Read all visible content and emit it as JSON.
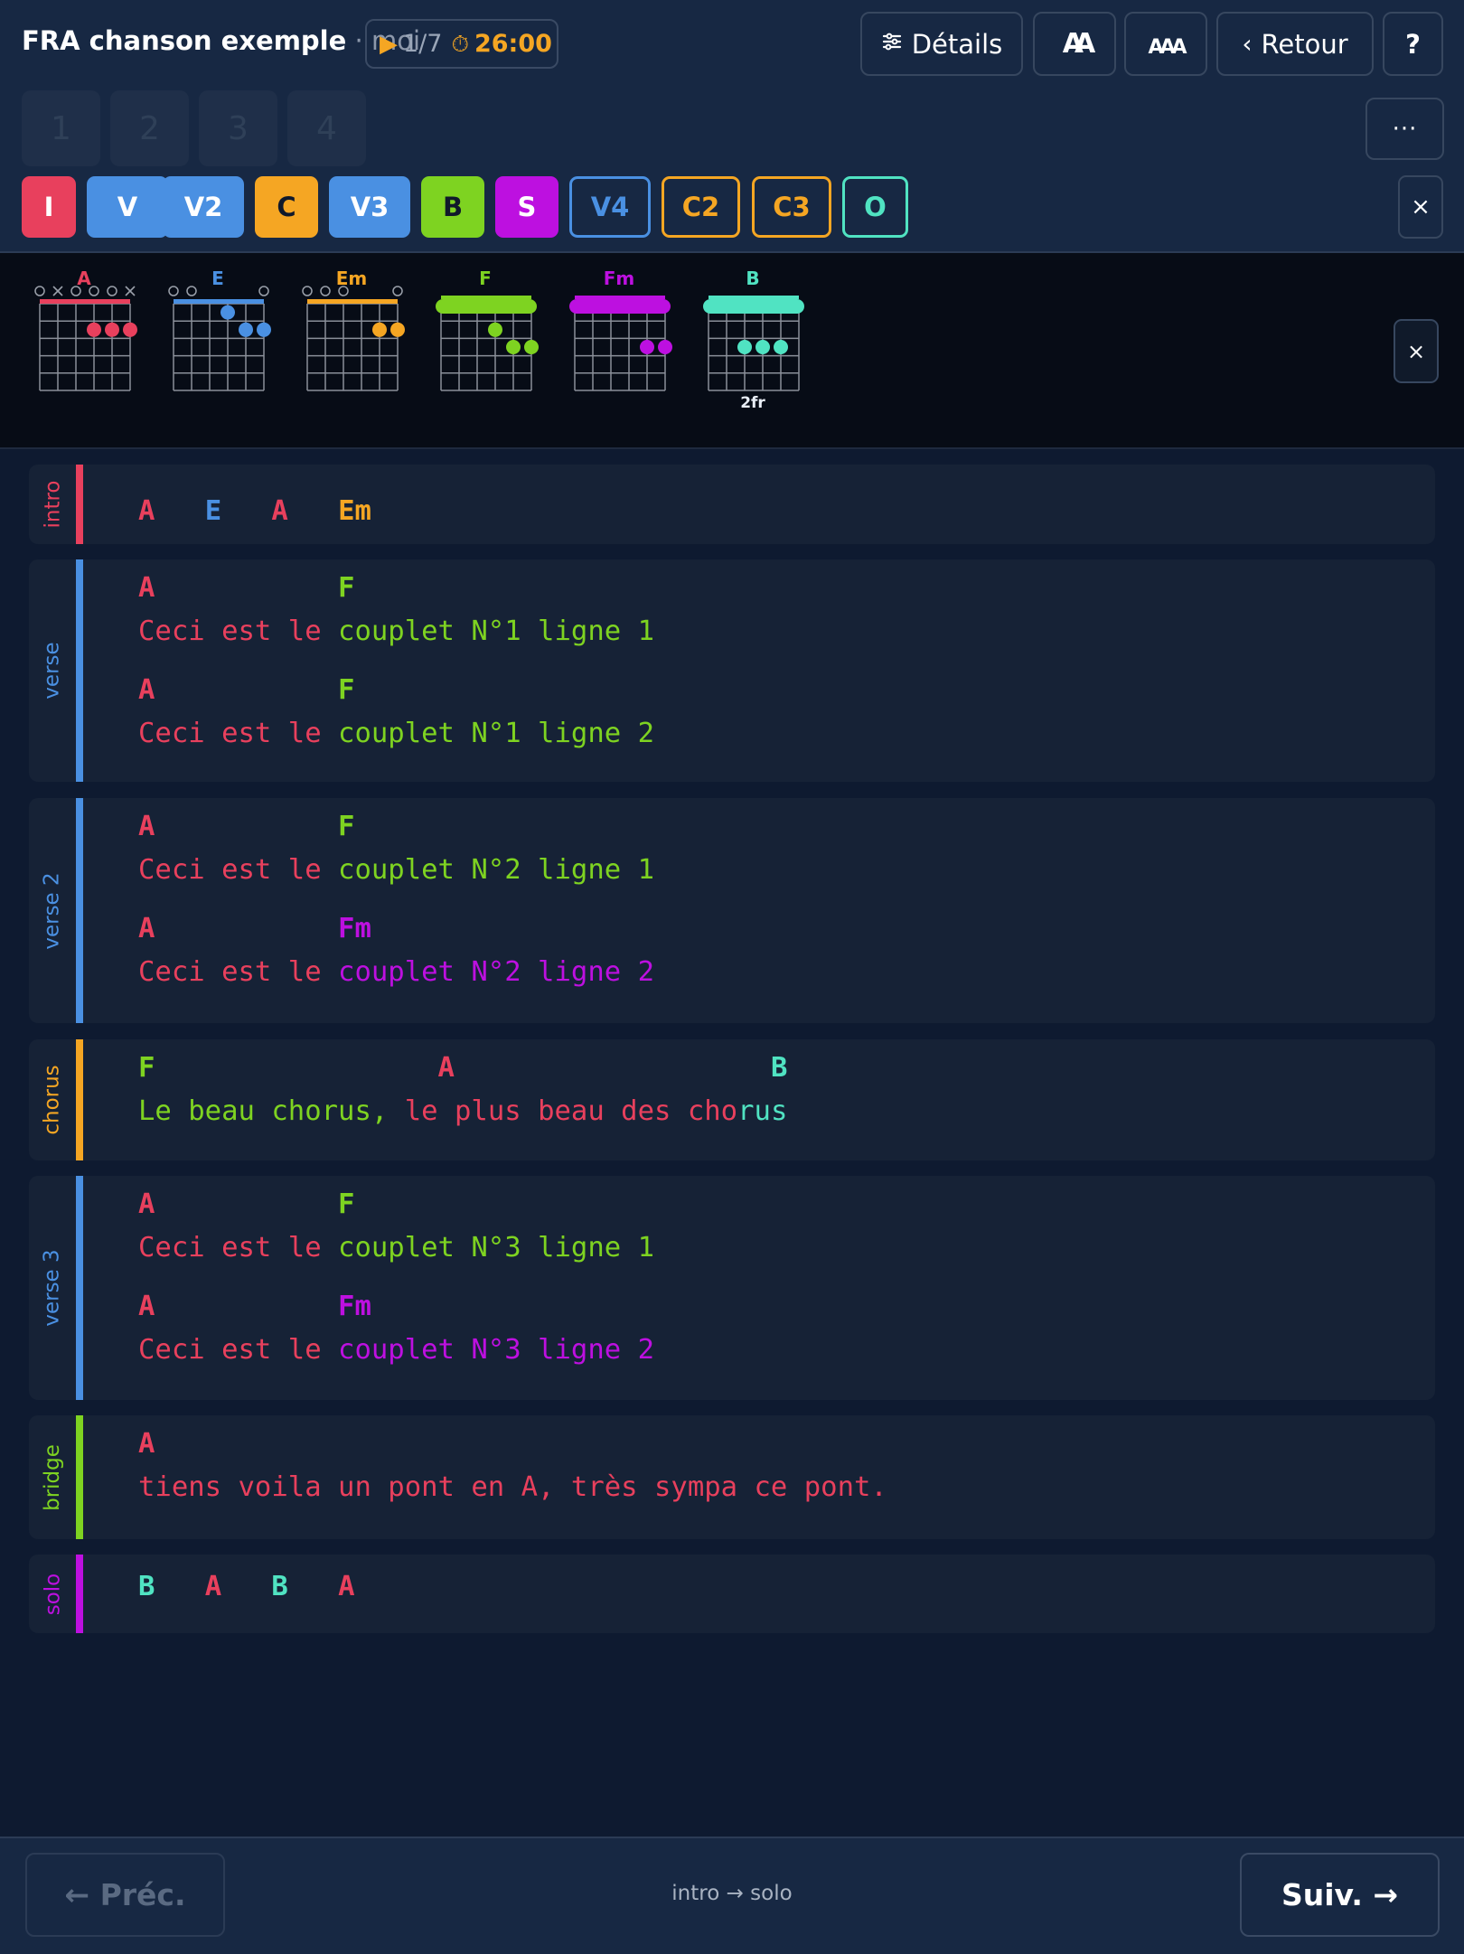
{
  "header": {
    "title": "FRA chanson exemple",
    "separator": "·",
    "author": "moi",
    "play_icon": "play-icon",
    "position": "1/7",
    "timer_icon": "stopwatch-icon",
    "timer": "26:00",
    "details_label": "Détails",
    "back_label": "Retour",
    "help_label": "?",
    "more_label": "···",
    "font_decrease_glyph": "AA",
    "font_increase_glyph": "AAA"
  },
  "pages": [
    "1",
    "2",
    "3",
    "4"
  ],
  "sections_nav": [
    {
      "label": "I",
      "color": "#e8405d",
      "style": "filled"
    },
    {
      "label": "V",
      "color": "#4a90e2",
      "style": "filled"
    },
    {
      "label": "V2",
      "color": "#4a90e2",
      "style": "filled"
    },
    {
      "label": "C",
      "color": "#f5a623",
      "style": "filled"
    },
    {
      "label": "V3",
      "color": "#4a90e2",
      "style": "filled"
    },
    {
      "label": "B",
      "color": "#7ed321",
      "style": "filled"
    },
    {
      "label": "S",
      "color": "#bd10e0",
      "style": "filled"
    },
    {
      "label": "V4",
      "color": "#4a90e2",
      "style": "outline"
    },
    {
      "label": "C2",
      "color": "#f5a623",
      "style": "outline"
    },
    {
      "label": "C3",
      "color": "#f5a623",
      "style": "outline"
    },
    {
      "label": "O",
      "color": "#50e3c2",
      "style": "outline"
    }
  ],
  "close_label": "×",
  "chords": [
    {
      "name": "A",
      "color": "#e8405d",
      "markers": [
        "o",
        "x",
        "o",
        "o",
        "o",
        "x"
      ],
      "barre": false,
      "fret_label": "",
      "dots": [
        [
          3,
          2
        ],
        [
          4,
          2
        ],
        [
          5,
          2
        ]
      ]
    },
    {
      "name": "E",
      "color": "#4a90e2",
      "markers": [
        "o",
        "o",
        "",
        "",
        "",
        "o"
      ],
      "barre": false,
      "fret_label": "",
      "dots": [
        [
          3,
          1
        ],
        [
          4,
          2
        ],
        [
          5,
          2
        ]
      ]
    },
    {
      "name": "Em",
      "color": "#f5a623",
      "markers": [
        "o",
        "o",
        "o",
        "",
        "",
        "o"
      ],
      "barre": false,
      "fret_label": "",
      "dots": [
        [
          4,
          2
        ],
        [
          5,
          2
        ]
      ]
    },
    {
      "name": "F",
      "color": "#7ed321",
      "markers": [
        "",
        "",
        "",
        "",
        "",
        ""
      ],
      "barre": true,
      "fret_label": "",
      "dots": [
        [
          3,
          2
        ],
        [
          4,
          3
        ],
        [
          5,
          3
        ]
      ]
    },
    {
      "name": "Fm",
      "color": "#bd10e0",
      "markers": [
        "",
        "",
        "",
        "",
        "",
        ""
      ],
      "barre": true,
      "fret_label": "",
      "dots": [
        [
          4,
          3
        ],
        [
          5,
          3
        ]
      ]
    },
    {
      "name": "B",
      "color": "#50e3c2",
      "markers": [
        "",
        "",
        "",
        "",
        "",
        ""
      ],
      "barre": true,
      "fret_label": "2fr",
      "dots": [
        [
          2,
          3
        ],
        [
          3,
          3
        ],
        [
          4,
          3
        ]
      ]
    }
  ],
  "song": [
    {
      "label": "intro",
      "color": "#e8405d",
      "lines": [
        {
          "type": "chords",
          "segments": [
            {
              "text": "A   ",
              "color": "#e8405d"
            },
            {
              "text": "E   ",
              "color": "#4a90e2"
            },
            {
              "text": "A   ",
              "color": "#e8405d"
            },
            {
              "text": "Em",
              "color": "#f5a623"
            }
          ]
        }
      ]
    },
    {
      "label": "verse",
      "color": "#4a90e2",
      "lines": [
        {
          "type": "chords",
          "segments": [
            {
              "text": "A           ",
              "color": "#e8405d"
            },
            {
              "text": "F",
              "color": "#7ed321"
            }
          ]
        },
        {
          "type": "lyrics",
          "segments": [
            {
              "text": "Ceci est le ",
              "color": "#e8405d"
            },
            {
              "text": "couplet N°1 ligne 1",
              "color": "#7ed321"
            }
          ]
        },
        {
          "type": "chords",
          "segments": [
            {
              "text": "A           ",
              "color": "#e8405d"
            },
            {
              "text": "F",
              "color": "#7ed321"
            }
          ]
        },
        {
          "type": "lyrics",
          "segments": [
            {
              "text": "Ceci est le ",
              "color": "#e8405d"
            },
            {
              "text": "couplet N°1 ligne 2",
              "color": "#7ed321"
            }
          ]
        }
      ]
    },
    {
      "label": "verse 2",
      "color": "#4a90e2",
      "lines": [
        {
          "type": "chords",
          "segments": [
            {
              "text": "A           ",
              "color": "#e8405d"
            },
            {
              "text": "F",
              "color": "#7ed321"
            }
          ]
        },
        {
          "type": "lyrics",
          "segments": [
            {
              "text": "Ceci est le ",
              "color": "#e8405d"
            },
            {
              "text": "couplet N°2 ligne 1",
              "color": "#7ed321"
            }
          ]
        },
        {
          "type": "chords",
          "segments": [
            {
              "text": "A           ",
              "color": "#e8405d"
            },
            {
              "text": "Fm",
              "color": "#bd10e0"
            }
          ]
        },
        {
          "type": "lyrics",
          "segments": [
            {
              "text": "Ceci est le ",
              "color": "#e8405d"
            },
            {
              "text": "couplet N°2 ligne 2",
              "color": "#bd10e0"
            }
          ]
        }
      ]
    },
    {
      "label": "chorus",
      "color": "#f5a623",
      "lines": [
        {
          "type": "chords",
          "segments": [
            {
              "text": "F                 ",
              "color": "#7ed321"
            },
            {
              "text": "A                   ",
              "color": "#e8405d"
            },
            {
              "text": "B",
              "color": "#50e3c2"
            }
          ]
        },
        {
          "type": "lyrics",
          "segments": [
            {
              "text": "Le beau chorus, ",
              "color": "#7ed321"
            },
            {
              "text": "le plus beau des cho",
              "color": "#e8405d"
            },
            {
              "text": "rus",
              "color": "#50e3c2"
            }
          ]
        }
      ]
    },
    {
      "label": "verse 3",
      "color": "#4a90e2",
      "lines": [
        {
          "type": "chords",
          "segments": [
            {
              "text": "A           ",
              "color": "#e8405d"
            },
            {
              "text": "F",
              "color": "#7ed321"
            }
          ]
        },
        {
          "type": "lyrics",
          "segments": [
            {
              "text": "Ceci est le ",
              "color": "#e8405d"
            },
            {
              "text": "couplet N°3 ligne 1",
              "color": "#7ed321"
            }
          ]
        },
        {
          "type": "chords",
          "segments": [
            {
              "text": "A           ",
              "color": "#e8405d"
            },
            {
              "text": "Fm",
              "color": "#bd10e0"
            }
          ]
        },
        {
          "type": "lyrics",
          "segments": [
            {
              "text": "Ceci est le ",
              "color": "#e8405d"
            },
            {
              "text": "couplet N°3 ligne 2",
              "color": "#bd10e0"
            }
          ]
        }
      ]
    },
    {
      "label": "bridge",
      "color": "#7ed321",
      "lines": [
        {
          "type": "chords",
          "segments": [
            {
              "text": "A",
              "color": "#e8405d"
            }
          ]
        },
        {
          "type": "lyrics",
          "segments": [
            {
              "text": "tiens voila un pont en A, très sympa ce pont.",
              "color": "#e8405d"
            }
          ]
        }
      ]
    },
    {
      "label": "solo",
      "color": "#bd10e0",
      "lines": [
        {
          "type": "chords",
          "segments": [
            {
              "text": "B   ",
              "color": "#50e3c2"
            },
            {
              "text": "A   ",
              "color": "#e8405d"
            },
            {
              "text": "B   ",
              "color": "#50e3c2"
            },
            {
              "text": "A",
              "color": "#e8405d"
            }
          ]
        }
      ]
    }
  ],
  "footer": {
    "prev_label": "← Préc.",
    "path": "intro → solo",
    "next_label": "Suiv. →"
  }
}
